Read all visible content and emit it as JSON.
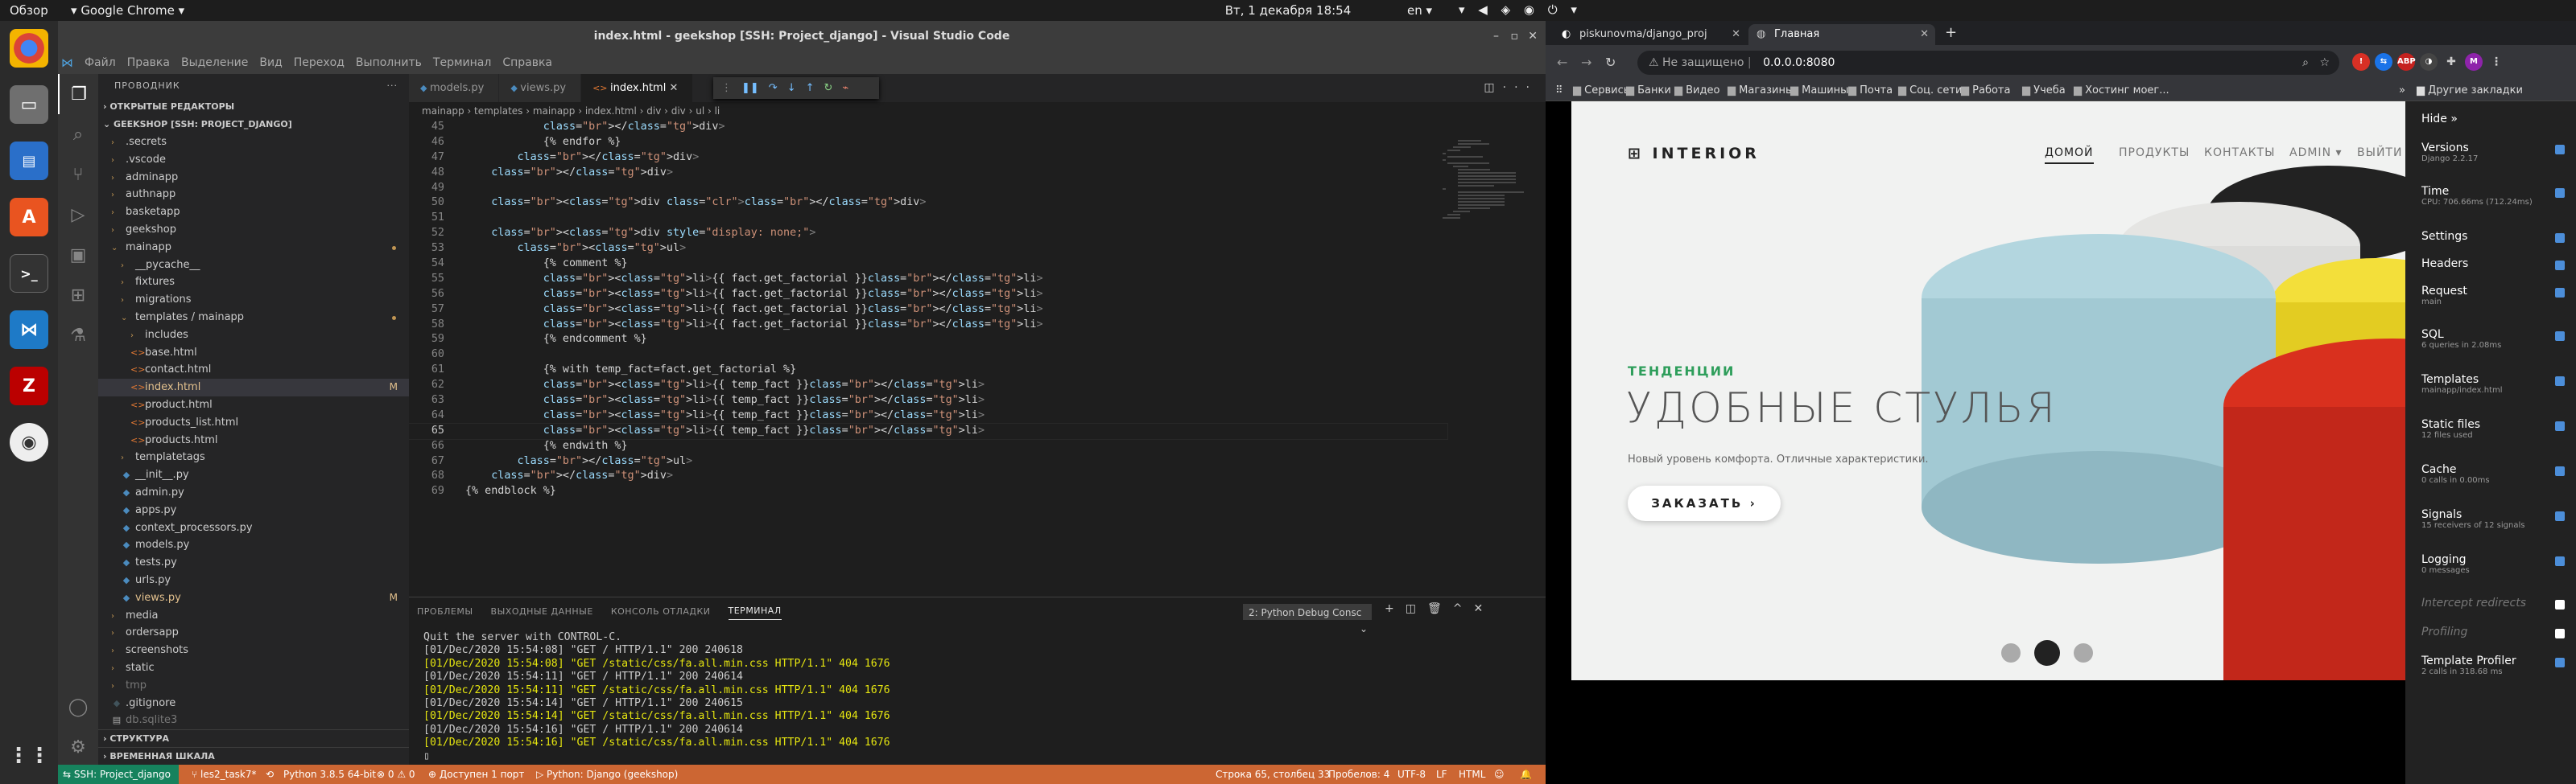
{
  "os": {
    "activities": "Обзор",
    "app": "Google Chrome",
    "clock": "Вт, 1 декабря  18:54",
    "lang": "en"
  },
  "vscode": {
    "title": "index.html - geekshop [SSH: Project_django] - Visual Studio Code",
    "menu": [
      "Файл",
      "Правка",
      "Выделение",
      "Вид",
      "Переход",
      "Выполнить",
      "Терминал",
      "Справка"
    ],
    "explorer": {
      "header": "ПРОВОДНИК",
      "open_editors": "ОТКРЫТЫЕ РЕДАКТОРЫ",
      "root": "GEEKSHOP [SSH: PROJECT_DJANGO]",
      "tree": [
        {
          "label": ".secrets",
          "kind": "folder",
          "level": 1
        },
        {
          "label": ".vscode",
          "kind": "folder",
          "level": 1
        },
        {
          "label": "adminapp",
          "kind": "folder",
          "level": 1
        },
        {
          "label": "authnapp",
          "kind": "folder",
          "level": 1
        },
        {
          "label": "basketapp",
          "kind": "folder",
          "level": 1
        },
        {
          "label": "geekshop",
          "kind": "folder",
          "level": 1
        },
        {
          "label": "mainapp",
          "kind": "folder-open",
          "level": 1,
          "dot": true
        },
        {
          "label": "__pycache__",
          "kind": "folder",
          "level": 2
        },
        {
          "label": "fixtures",
          "kind": "folder",
          "level": 2
        },
        {
          "label": "migrations",
          "kind": "folder",
          "level": 2
        },
        {
          "label": "templates / mainapp",
          "kind": "folder-open",
          "level": 2,
          "dot": true
        },
        {
          "label": "includes",
          "kind": "folder",
          "level": 3
        },
        {
          "label": "base.html",
          "kind": "html",
          "level": 3
        },
        {
          "label": "contact.html",
          "kind": "html",
          "level": 3
        },
        {
          "label": "index.html",
          "kind": "html",
          "level": 3,
          "badge": "M",
          "selected": true
        },
        {
          "label": "product.html",
          "kind": "html",
          "level": 3
        },
        {
          "label": "products_list.html",
          "kind": "html",
          "level": 3
        },
        {
          "label": "products.html",
          "kind": "html",
          "level": 3
        },
        {
          "label": "templatetags",
          "kind": "folder",
          "level": 2
        },
        {
          "label": "__init__.py",
          "kind": "py",
          "level": 2
        },
        {
          "label": "admin.py",
          "kind": "py",
          "level": 2
        },
        {
          "label": "apps.py",
          "kind": "py",
          "level": 2
        },
        {
          "label": "context_processors.py",
          "kind": "py",
          "level": 2
        },
        {
          "label": "models.py",
          "kind": "py",
          "level": 2
        },
        {
          "label": "tests.py",
          "kind": "py",
          "level": 2
        },
        {
          "label": "urls.py",
          "kind": "py",
          "level": 2
        },
        {
          "label": "views.py",
          "kind": "py",
          "level": 2,
          "badge": "M"
        },
        {
          "label": "media",
          "kind": "folder",
          "level": 1
        },
        {
          "label": "ordersapp",
          "kind": "folder",
          "level": 1
        },
        {
          "label": "screenshots",
          "kind": "folder",
          "level": 1
        },
        {
          "label": "static",
          "kind": "folder",
          "level": 1
        },
        {
          "label": "tmp",
          "kind": "folder",
          "level": 1,
          "dim": true
        },
        {
          "label": ".gitignore",
          "kind": "git",
          "level": 1
        },
        {
          "label": "db.sqlite3",
          "kind": "db",
          "level": 1,
          "dim": true
        }
      ],
      "outline": "СТРУКТУРА",
      "timeline": "ВРЕМЕННАЯ ШКАЛА"
    },
    "tabs": [
      {
        "label": "models.py",
        "icon": "py"
      },
      {
        "label": "views.py",
        "icon": "py"
      },
      {
        "label": "index.html",
        "icon": "html",
        "active": true
      }
    ],
    "breadcrumb": "mainapp  ›  templates  ›  mainapp  ›  index.html  ›  div  ›  div  ›  ul  ›  li",
    "code": [
      {
        "n": "45",
        "t": "            </div>"
      },
      {
        "n": "46",
        "t": "            {% endfor %}"
      },
      {
        "n": "47",
        "t": "        </div>"
      },
      {
        "n": "48",
        "t": "    </div>"
      },
      {
        "n": "49",
        "t": ""
      },
      {
        "n": "50",
        "t": "    <div class=\"clr\"></div>"
      },
      {
        "n": "51",
        "t": ""
      },
      {
        "n": "52",
        "t": "    <div style=\"display: none;\">"
      },
      {
        "n": "53",
        "t": "        <ul>"
      },
      {
        "n": "54",
        "t": "            {% comment %}"
      },
      {
        "n": "55",
        "t": "            <li>{{ fact.get_factorial }}</li>"
      },
      {
        "n": "56",
        "t": "            <li>{{ fact.get_factorial }}</li>"
      },
      {
        "n": "57",
        "t": "            <li>{{ fact.get_factorial }}</li>"
      },
      {
        "n": "58",
        "t": "            <li>{{ fact.get_factorial }}</li>"
      },
      {
        "n": "59",
        "t": "            {% endcomment %}"
      },
      {
        "n": "60",
        "t": ""
      },
      {
        "n": "61",
        "t": "            {% with temp_fact=fact.get_factorial %}"
      },
      {
        "n": "62",
        "t": "            <li>{{ temp_fact }}</li>"
      },
      {
        "n": "63",
        "t": "            <li>{{ temp_fact }}</li>"
      },
      {
        "n": "64",
        "t": "            <li>{{ temp_fact }}</li>"
      },
      {
        "n": "65",
        "t": "            <li>{{ temp_fact }}</li>",
        "current": true
      },
      {
        "n": "66",
        "t": "            {% endwith %}"
      },
      {
        "n": "67",
        "t": "        </ul>"
      },
      {
        "n": "68",
        "t": "    </div>"
      },
      {
        "n": "69",
        "t": "{% endblock %}"
      }
    ],
    "panel": {
      "tabs": [
        "ПРОБЛЕМЫ",
        "ВЫХОДНЫЕ ДАННЫЕ",
        "КОНСОЛЬ ОТЛАДКИ",
        "ТЕРМИНАЛ"
      ],
      "select": "2: Python Debug Consc",
      "terminal": [
        {
          "t": "Quit the server with CONTROL-C."
        },
        {
          "t": "[01/Dec/2020 15:54:08] \"GET / HTTP/1.1\" 200 240618"
        },
        {
          "t": "[01/Dec/2020 15:54:08] \"GET /static/css/fa.all.min.css HTTP/1.1\" 404 1676",
          "warn": true
        },
        {
          "t": "[01/Dec/2020 15:54:11] \"GET / HTTP/1.1\" 200 240614"
        },
        {
          "t": "[01/Dec/2020 15:54:11] \"GET /static/css/fa.all.min.css HTTP/1.1\" 404 1676",
          "warn": true
        },
        {
          "t": "[01/Dec/2020 15:54:14] \"GET / HTTP/1.1\" 200 240615"
        },
        {
          "t": "[01/Dec/2020 15:54:14] \"GET /static/css/fa.all.min.css HTTP/1.1\" 404 1676",
          "warn": true
        },
        {
          "t": "[01/Dec/2020 15:54:16] \"GET / HTTP/1.1\" 200 240614"
        },
        {
          "t": "[01/Dec/2020 15:54:16] \"GET /static/css/fa.all.min.css HTTP/1.1\" 404 1676",
          "warn": true
        }
      ]
    },
    "status": {
      "remote": "SSH: Project_django",
      "branch": "les2_task7*",
      "python": "Python 3.8.5 64-bit",
      "problems": "⊗ 0 ⚠ 0",
      "ports": "Доступен 1 порт",
      "debug": "Python: Django (geekshop)",
      "position": "Строка 65, столбец 33",
      "spaces": "Пробелов: 4",
      "encoding": "UTF-8",
      "eol": "LF",
      "lang": "HTML"
    }
  },
  "chrome": {
    "tabs": [
      {
        "label": "piskunovma/django_proj",
        "active": false
      },
      {
        "label": "Главная",
        "active": true
      }
    ],
    "url": {
      "security": "Не защищено",
      "address": "0.0.0.0:8080"
    },
    "bookmarks": [
      "Сервисы",
      "Банки",
      "Видео",
      "Магазины",
      "Машины",
      "Почта",
      "Соц. сети.",
      "Работа",
      "Учеба",
      "Хостинг моег..."
    ],
    "other_bookmarks": "Другие закладки",
    "avatar": "M",
    "site": {
      "logo": "INTERIOR",
      "nav": [
        "ДОМОЙ",
        "ПРОДУКТЫ",
        "КОНТАКТЫ",
        "ADMIN ▾",
        "ВЫЙТИ"
      ],
      "trend": "ТЕНДЕНЦИИ",
      "headline": "УДОБНЫЕ СТУЛЬЯ",
      "sub": "Новый уровень комфорта. Отличные характеристики.",
      "cta": "ЗАКАЗАТЬ"
    },
    "djdt": {
      "hide": "Hide »",
      "panels": [
        {
          "name": "Versions",
          "sub": "Django 2.2.17",
          "on": true
        },
        {
          "name": "Time",
          "sub": "CPU: 706.66ms (712.24ms)",
          "on": true
        },
        {
          "name": "Settings",
          "sub": "",
          "on": true
        },
        {
          "name": "Headers",
          "sub": "",
          "on": true
        },
        {
          "name": "Request",
          "sub": "main",
          "on": true
        },
        {
          "name": "SQL",
          "sub": "6 queries in 2.08ms",
          "on": true
        },
        {
          "name": "Templates",
          "sub": "mainapp/index.html",
          "on": true
        },
        {
          "name": "Static files",
          "sub": "12 files used",
          "on": true
        },
        {
          "name": "Cache",
          "sub": "0 calls in 0.00ms",
          "on": true
        },
        {
          "name": "Signals",
          "sub": "15 receivers of 12 signals",
          "on": true
        },
        {
          "name": "Logging",
          "sub": "0 messages",
          "on": true
        },
        {
          "name": "Intercept redirects",
          "sub": "",
          "on": false
        },
        {
          "name": "Profiling",
          "sub": "",
          "on": false
        },
        {
          "name": "Template Profiler",
          "sub": "2 calls in 318.68 ms",
          "on": true
        }
      ]
    }
  }
}
